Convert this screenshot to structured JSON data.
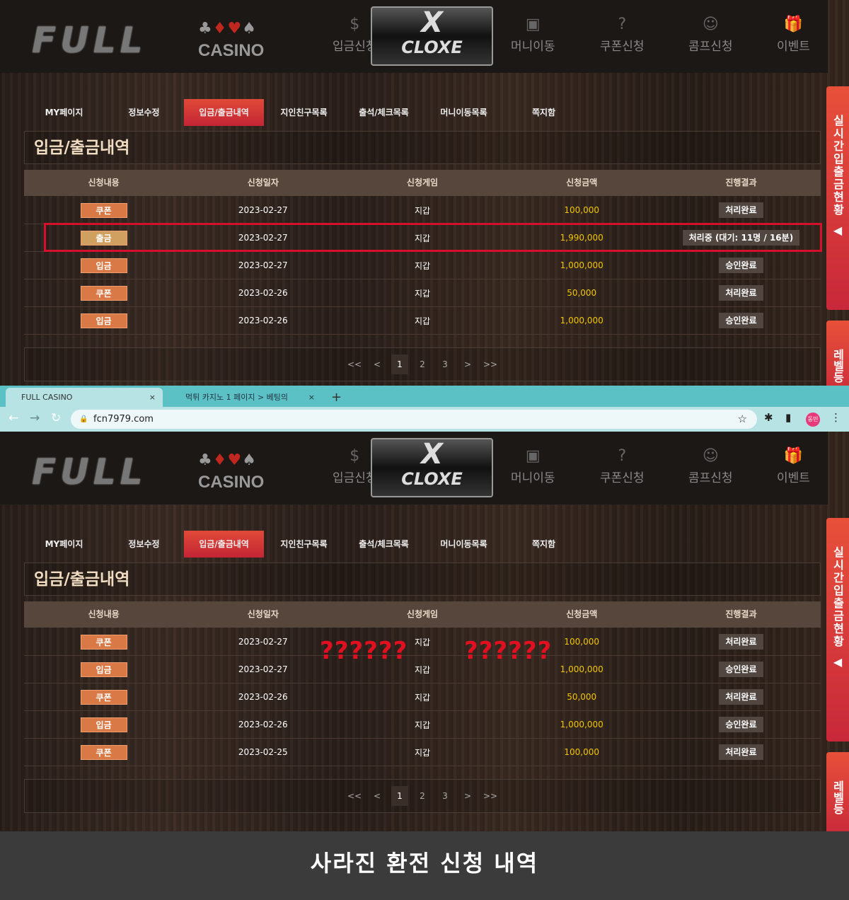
{
  "site": {
    "logo": "FULL",
    "logo_sub": "CASINO",
    "partner": "X",
    "partner_sub": "CLOXE",
    "nav": [
      "입금신청",
      "머니이동",
      "쿠폰신청",
      "콤프신청",
      "이벤트"
    ],
    "tabs": [
      "MY페이지",
      "정보수정",
      "입금/출금내역",
      "지인친구목록",
      "출석/체크목록",
      "머니이동목록",
      "쪽지함"
    ],
    "active_tab": 2,
    "page_title": "입금/출금내역",
    "columns": [
      "신청내용",
      "신청일자",
      "신청게임",
      "신청금액",
      "진행결과"
    ],
    "pager": [
      "<<",
      "<",
      "1",
      "2",
      "3",
      ">",
      ">>"
    ],
    "side_tab": "실시간입출금현황",
    "side_arrow": "◀",
    "side_tab2": "레벨등"
  },
  "before": {
    "rows": [
      {
        "type": "쿠폰",
        "date": "2023-02-27",
        "game": "지갑",
        "amount": "100,000",
        "status": "처리완료"
      },
      {
        "type": "출금",
        "date": "2023-02-27",
        "game": "지갑",
        "amount": "1,990,000",
        "status": "처리중 (대기: 11명 / 16분)"
      },
      {
        "type": "입금",
        "date": "2023-02-27",
        "game": "지갑",
        "amount": "1,000,000",
        "status": "승인완료"
      },
      {
        "type": "쿠폰",
        "date": "2023-02-26",
        "game": "지갑",
        "amount": "50,000",
        "status": "처리완료"
      },
      {
        "type": "입금",
        "date": "2023-02-26",
        "game": "지갑",
        "amount": "1,000,000",
        "status": "승인완료"
      }
    ]
  },
  "browser": {
    "tab1": "FULL CASINO",
    "tab2": "먹튀 카지노 1 페이지 > 베팅의",
    "url": "fcn7979.com",
    "profile": "동민"
  },
  "after": {
    "marks": "??????",
    "rows": [
      {
        "type": "쿠폰",
        "date": "2023-02-27",
        "game": "지갑",
        "amount": "100,000",
        "status": "처리완료"
      },
      {
        "type": "입금",
        "date": "2023-02-27",
        "game": "지갑",
        "amount": "1,000,000",
        "status": "승인완료"
      },
      {
        "type": "쿠폰",
        "date": "2023-02-26",
        "game": "지갑",
        "amount": "50,000",
        "status": "처리완료"
      },
      {
        "type": "입금",
        "date": "2023-02-26",
        "game": "지갑",
        "amount": "1,000,000",
        "status": "승인완료"
      },
      {
        "type": "쿠폰",
        "date": "2023-02-25",
        "game": "지갑",
        "amount": "100,000",
        "status": "처리완료"
      }
    ]
  },
  "caption": "사라진 환전 신청 내역",
  "colors": {
    "accent": "#d4102a",
    "amount": "#f2c500",
    "tab_active": "#c42535"
  }
}
